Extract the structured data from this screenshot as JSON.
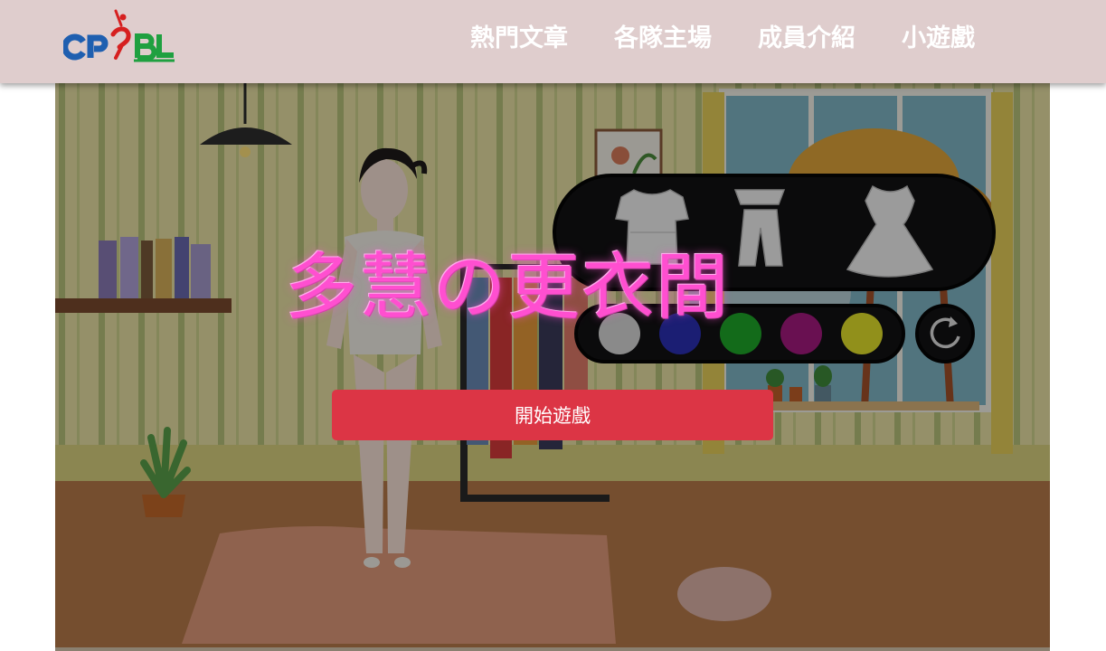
{
  "brand": {
    "logo_text": "CPBL",
    "logo_alt": "CPBL"
  },
  "nav": {
    "items": [
      {
        "label": "熱門文章"
      },
      {
        "label": "各隊主場"
      },
      {
        "label": "成員介紹"
      },
      {
        "label": "小遊戲"
      }
    ]
  },
  "game": {
    "title": "多慧の更衣間",
    "start_label": "開始遊戲",
    "clothing_options": [
      {
        "icon": "dress-icon"
      },
      {
        "icon": "top-and-pants-icon"
      },
      {
        "icon": "lace-dress-icon"
      }
    ],
    "color_options": [
      "#d8d8d8",
      "#2b2fb4",
      "#1fa82a",
      "#a4197f",
      "#e3e22b"
    ],
    "reset_icon": "reset-icon"
  },
  "colors": {
    "navbar_bg": "#dfcdcd",
    "nav_text": "#ffffff",
    "start_button": "#dc3545",
    "title_pink": "#ff4fd0"
  }
}
